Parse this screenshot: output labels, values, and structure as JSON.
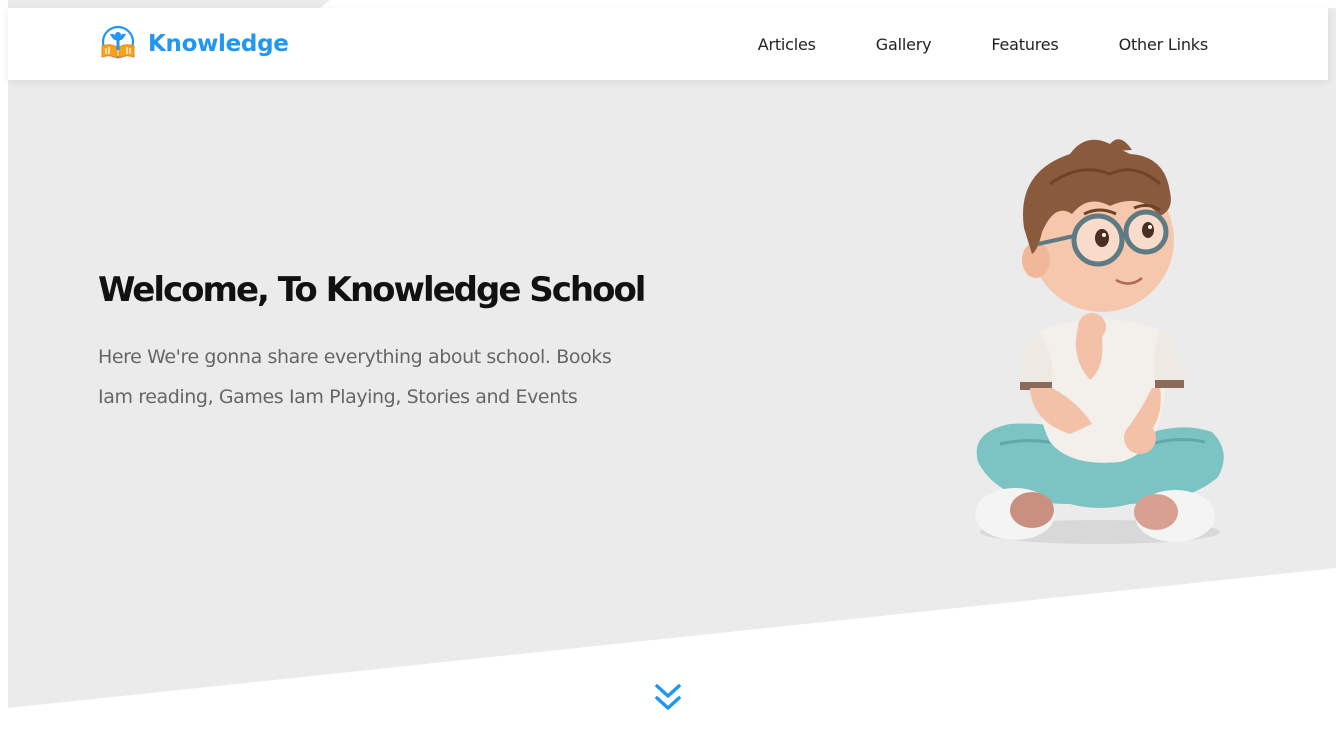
{
  "brand": {
    "name": "Knowledge",
    "logo_icon": "book-reader-icon",
    "color": "#2196f3"
  },
  "nav": {
    "items": [
      {
        "label": "Articles"
      },
      {
        "label": "Gallery"
      },
      {
        "label": "Features"
      },
      {
        "label": "Other Links"
      }
    ]
  },
  "hero": {
    "title": "Welcome, To Knowledge School",
    "description": "Here We're gonna share everything about school. Books Iam reading, Games Iam Playing, Stories and Events",
    "background": "#ebebeb",
    "illustration": "boy-with-glasses-thinking"
  },
  "scroll": {
    "icon": "double-chevron-down-icon",
    "color": "#2196f3"
  }
}
